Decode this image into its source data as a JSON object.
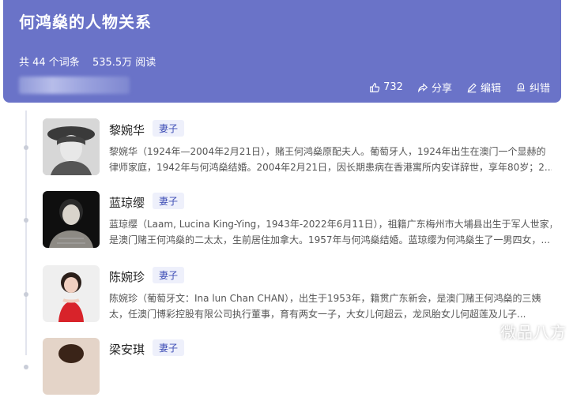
{
  "header": {
    "title": "何鸿燊的人物关系",
    "stats": {
      "entries": "共 44 个词条",
      "reads": "535.5万 阅读"
    },
    "actions": {
      "like": "732",
      "share": "分享",
      "edit": "编辑",
      "report": "纠错"
    }
  },
  "people": [
    {
      "name": "黎婉华",
      "tag": "妻子",
      "line1": "黎婉华（1924年—2004年2月21日），赌王何鸿燊原配夫人。葡萄牙人，1924年出生在澳门一个显赫的",
      "line2": "律师家庭，1942年与何鸿燊结婚。2004年2月21日，因长期患病在香港寓所内安详辞世，享年80岁；2..."
    },
    {
      "name": "蓝琼缨",
      "tag": "妻子",
      "line1": "蓝琼缨（Laam, Lucina King-Ying，1943年-2022年6月11日），祖籍广东梅州市大埔县出生于军人世家，",
      "line2": "是澳门赌王何鸿燊的二太太，生前居住加拿大。1957年与何鸿燊结婚。蓝琼缨为何鸿燊生了一男四女，..."
    },
    {
      "name": "陈婉珍",
      "tag": "妻子",
      "line1": "陈婉珍（葡萄牙文：Ina lun Chan CHAN），出生于1953年，籍贯广东新会，是澳门赌王何鸿燊的三姨",
      "line2": "太，任澳门博彩控股有限公司执行董事，育有两女一子，大女儿何超云，龙凤胎女儿何超莲及儿子..."
    },
    {
      "name": "梁安琪",
      "tag": "妻子",
      "line1": "",
      "line2": ""
    }
  ],
  "watermark": "微品八方"
}
